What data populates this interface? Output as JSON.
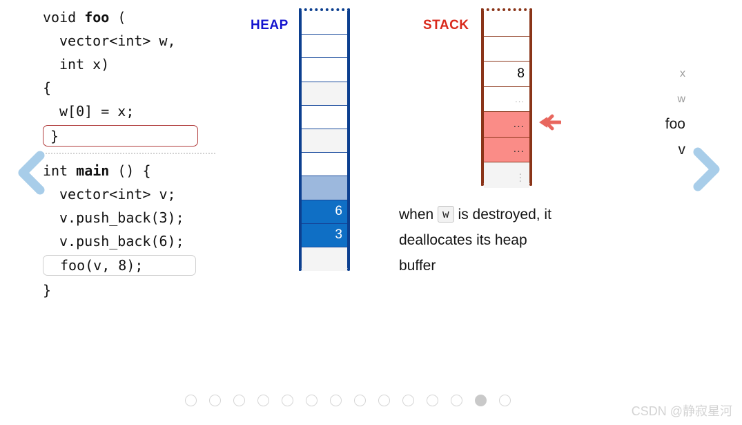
{
  "code": {
    "lines": [
      {
        "text": "void ",
        "bold_text": "foo",
        "tail": " (",
        "indent": false
      },
      {
        "text": "vector<int> w,",
        "indent": true
      },
      {
        "text": "int x)",
        "indent": true
      },
      {
        "text": "{",
        "indent": false
      },
      {
        "text": "w[0] = x;",
        "indent": true
      }
    ],
    "highlight_box_1": "}",
    "lines_after": [
      {
        "pre": "int ",
        "bold_text": "main",
        "tail": " () {",
        "indent": false
      },
      {
        "text": "vector<int> v;",
        "indent": true
      },
      {
        "text": "v.push_back(3);",
        "indent": true
      },
      {
        "text": "v.push_back(6);",
        "indent": true
      }
    ],
    "highlight_box_2": "foo(v, 8);",
    "closing_brace": "}"
  },
  "nav": {
    "prev_label": "previous-slide",
    "next_label": "next-slide"
  },
  "heap": {
    "label": "HEAP",
    "label_color": "#1414cf",
    "border_color": "#0c3f8f",
    "cells": [
      {
        "value": "",
        "style": "empty"
      },
      {
        "value": "",
        "style": "empty"
      },
      {
        "value": "",
        "style": "empty"
      },
      {
        "value": "",
        "style": "shade"
      },
      {
        "value": "",
        "style": "empty"
      },
      {
        "value": "",
        "style": "shade"
      },
      {
        "value": "",
        "style": "empty"
      },
      {
        "value": "",
        "style": "lblue"
      },
      {
        "value": "6",
        "style": "blue"
      },
      {
        "value": "3",
        "style": "blue"
      },
      {
        "value": "",
        "style": "shade"
      }
    ]
  },
  "stack": {
    "label": "STACK",
    "label_color": "#d92a1c",
    "border_color": "#8a3418",
    "rows": [
      {
        "label": "",
        "label_size": "small",
        "value": "",
        "style": "empty",
        "value_kind": "text"
      },
      {
        "label": "",
        "label_size": "small",
        "value": "",
        "style": "empty",
        "value_kind": "text"
      },
      {
        "label": "x",
        "label_size": "small",
        "value": "8",
        "style": "empty",
        "value_kind": "text"
      },
      {
        "label": "w",
        "label_size": "small",
        "value": "...",
        "style": "empty",
        "value_kind": "dots-faint"
      },
      {
        "label": "foo",
        "label_size": "big",
        "value": "...",
        "style": "salmon",
        "value_kind": "dots"
      },
      {
        "label": "v",
        "label_size": "big",
        "value": "...",
        "style": "salmon",
        "value_kind": "dots"
      },
      {
        "label": "",
        "label_size": "small",
        "value": "",
        "style": "shade",
        "value_kind": "vdots"
      }
    ],
    "arrow_color": "#e8675e"
  },
  "explanation": {
    "part1": "when ",
    "code_token": "w",
    "part2": " is destroyed, it deallocates its heap buffer"
  },
  "pager": {
    "total": 14,
    "active_index": 12
  },
  "watermark": "CSDN @静寂星河"
}
